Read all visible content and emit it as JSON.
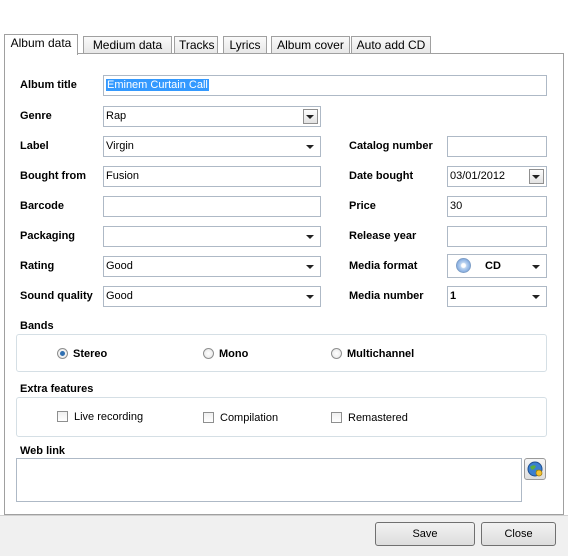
{
  "tabs": [
    "Album data",
    "Medium data",
    "Tracks",
    "Lyrics",
    "Album cover",
    "Auto add  CD"
  ],
  "album_title": {
    "label": "Album title",
    "value": "Eminem Curtain Call"
  },
  "genre": {
    "label": "Genre",
    "value": "Rap"
  },
  "label": {
    "label": "Label",
    "value": "Virgin"
  },
  "bought_from": {
    "label": "Bought from",
    "value": "Fusion"
  },
  "barcode": {
    "label": "Barcode",
    "value": ""
  },
  "packaging": {
    "label": "Packaging",
    "value": ""
  },
  "rating": {
    "label": "Rating",
    "value": "Good"
  },
  "sound_quality": {
    "label": "Sound quality",
    "value": "Good"
  },
  "catalog_number": {
    "label": "Catalog number",
    "value": ""
  },
  "date_bought": {
    "label": "Date bought",
    "value": "03/01/2012"
  },
  "price": {
    "label": "Price",
    "value": "30"
  },
  "release_year": {
    "label": "Release year",
    "value": ""
  },
  "media_format": {
    "label": "Media format",
    "value": "CD"
  },
  "media_number": {
    "label": "Media number",
    "value": "1"
  },
  "bands": {
    "label": "Bands",
    "options": [
      "Stereo",
      "Mono",
      "Multichannel"
    ],
    "selected": "Stereo"
  },
  "extra_features": {
    "label": "Extra features",
    "options": [
      "Live recording",
      "Compilation",
      "Remastered"
    ]
  },
  "web_link": {
    "label": "Web link",
    "value": ""
  },
  "buttons": {
    "save": "Save",
    "close": "Close"
  },
  "colors": {
    "selection": "#3399ff",
    "radio_dot": "#2f6fb1"
  }
}
